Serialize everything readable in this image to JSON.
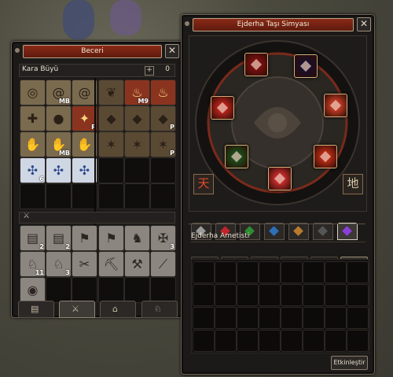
{
  "skill_window": {
    "title": "Beceri",
    "close_glyph": "✕",
    "category": "Kara Büyü",
    "points_icon": "plus-icon",
    "points": "0",
    "skills": [
      {
        "icon": "circle-icon",
        "badge": ""
      },
      {
        "icon": "spiral-icon",
        "badge": "MB"
      },
      {
        "icon": "spiral-icon",
        "badge": ""
      },
      {
        "icon": "leaf-icon",
        "badge": ""
      },
      {
        "icon": "flame-icon",
        "badge": "M9"
      },
      {
        "icon": "flame-icon",
        "badge": ""
      },
      {
        "icon": "cross-icon",
        "badge": ""
      },
      {
        "icon": "orb-icon",
        "badge": ""
      },
      {
        "icon": "rune-icon",
        "badge": "P"
      },
      {
        "icon": "drop-icon",
        "badge": ""
      },
      {
        "icon": "drop-icon",
        "badge": ""
      },
      {
        "icon": "drop-icon",
        "badge": "P"
      },
      {
        "icon": "hand-icon",
        "badge": ""
      },
      {
        "icon": "hand-icon",
        "badge": "MB"
      },
      {
        "icon": "hand-icon",
        "badge": ""
      },
      {
        "icon": "star-icon",
        "badge": ""
      },
      {
        "icon": "star-icon",
        "badge": ""
      },
      {
        "icon": "star-icon",
        "badge": "P"
      },
      {
        "icon": "whirl-icon",
        "badge": "6"
      },
      {
        "icon": "whirl-icon",
        "badge": ""
      },
      {
        "icon": "whirl-icon",
        "badge": ""
      }
    ],
    "support_skills": [
      {
        "icon": "book-icon",
        "badge": "2"
      },
      {
        "icon": "book-icon",
        "badge": "2"
      },
      {
        "icon": "flag-icon",
        "badge": ""
      },
      {
        "icon": "flag-icon",
        "badge": ""
      },
      {
        "icon": "knight-icon",
        "badge": ""
      },
      {
        "icon": "knot-icon",
        "badge": "3"
      },
      {
        "icon": "horse-icon",
        "badge": "11"
      },
      {
        "icon": "horse-icon",
        "badge": "3"
      },
      {
        "icon": "scissors-icon",
        "badge": ""
      },
      {
        "icon": "pickaxe-icon",
        "badge": ""
      },
      {
        "icon": "hammer-icon",
        "badge": ""
      },
      {
        "icon": "wand-icon",
        "badge": ""
      },
      {
        "icon": "target-icon",
        "badge": ""
      }
    ],
    "bottom_tabs": [
      "book-icon",
      "sword-icon",
      "camp-icon",
      "horse-icon"
    ]
  },
  "dragon_window": {
    "title": "Ejderha Taşı Simyası",
    "close_glyph": "✕",
    "left_glyph": "天",
    "right_glyph": "地",
    "wheel_gems": [
      {
        "color": "#7a1010",
        "name": "ruby"
      },
      {
        "color": "#1a0f2a",
        "name": "amethyst"
      },
      {
        "color": "#b3221a",
        "name": "garnet"
      },
      {
        "color": "#c03a24",
        "name": "onyx"
      },
      {
        "color": "#1c4a1a",
        "name": "jade"
      },
      {
        "color": "#b52a14",
        "name": "topaz"
      },
      {
        "color": "#c22b2b",
        "name": "sapphire"
      }
    ],
    "gem_tabs": [
      {
        "color": "#9b9b9b"
      },
      {
        "color": "#c0242a"
      },
      {
        "color": "#2e8d32"
      },
      {
        "color": "#2e6fb8"
      },
      {
        "color": "#b87a2e"
      },
      {
        "color": "#555555"
      },
      {
        "color": "#8b3dd8"
      }
    ],
    "section_label": "Ejderha Ametisti",
    "grade_options": [
      "☼",
      "☼",
      "☼",
      "☼",
      "☼",
      "☼"
    ],
    "action_button": "Etkinleştir"
  }
}
